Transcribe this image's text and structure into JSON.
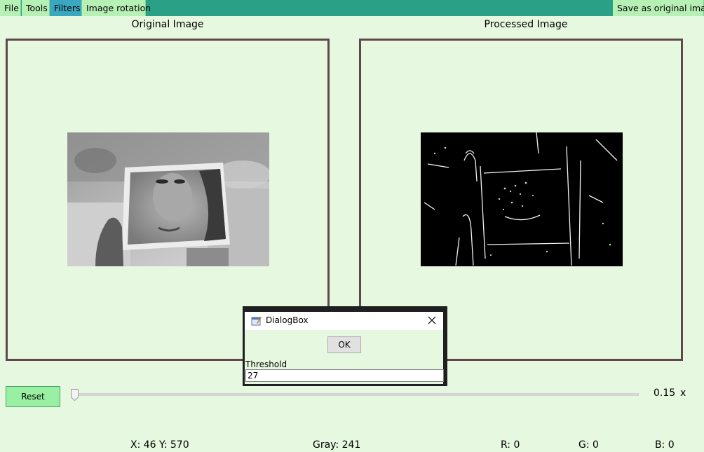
{
  "menu": {
    "file": "File",
    "tools": "Tools",
    "filters": "Filters",
    "image_rotation": "Image rotation",
    "save_as_original": "Save as original image"
  },
  "panels": {
    "original_title": "Original Image",
    "processed_title": "Processed Image"
  },
  "controls": {
    "reset_label": "Reset",
    "zoom_value": "0.15",
    "zoom_suffix": "x",
    "slider_fraction": 0.0
  },
  "status": {
    "coords": "X: 46 Y: 570",
    "gray": "Gray: 241",
    "r": "R: 0",
    "g": "G: 0",
    "b": "B: 0"
  },
  "dialog": {
    "title": "DialogBox",
    "ok_label": "OK",
    "threshold_label": "Threshold",
    "threshold_value": "27"
  },
  "colors": {
    "background": "#e6f8df",
    "menubar": "#2aa186",
    "menu_item": "#b7f0b5",
    "menu_active": "#3aa6bf",
    "frame_border": "#5e4a4a",
    "reset_button": "#99f0a3"
  },
  "icons": {
    "dialog_icon": "app-window-icon",
    "close_icon": "close-icon",
    "slider_thumb": "slider-thumb-icon"
  }
}
